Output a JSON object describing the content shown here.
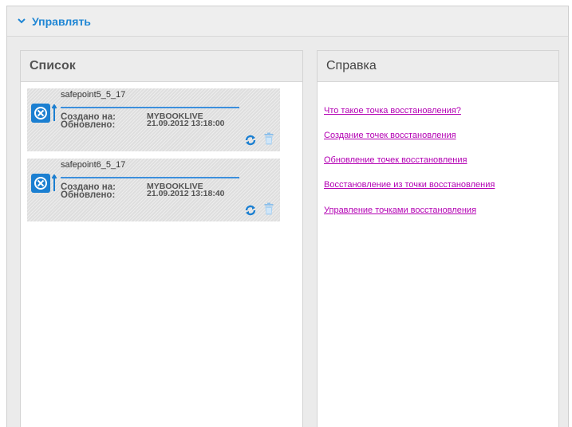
{
  "manage": {
    "title": "Управлять"
  },
  "list_panel": {
    "title": "Список",
    "items": [
      {
        "name": "safepoint5_5_17",
        "created_label": "Создано на:",
        "created_value": "MYBOOKLIVE",
        "updated_label": "Обновлено:",
        "updated_value": "21.09.2012 13:18:00"
      },
      {
        "name": "safepoint6_5_17",
        "created_label": "Создано на:",
        "created_value": "MYBOOKLIVE",
        "updated_label": "Обновлено:",
        "updated_value": "21.09.2012 13:18:40"
      }
    ]
  },
  "help_panel": {
    "title": "Справка",
    "links": [
      "Что такое точка восстановления?",
      "Создание точек восстановления",
      "Обновление точек восстановления",
      "Восстановление из точки восстановления",
      "Управление точками восстановления"
    ]
  },
  "colors": {
    "accent": "#1f86d4",
    "link": "#b300b3",
    "bar": "#3c8fdc"
  },
  "icons": [
    "chevron-down-icon",
    "safepoint-icon",
    "refresh-icon",
    "trash-icon"
  ]
}
